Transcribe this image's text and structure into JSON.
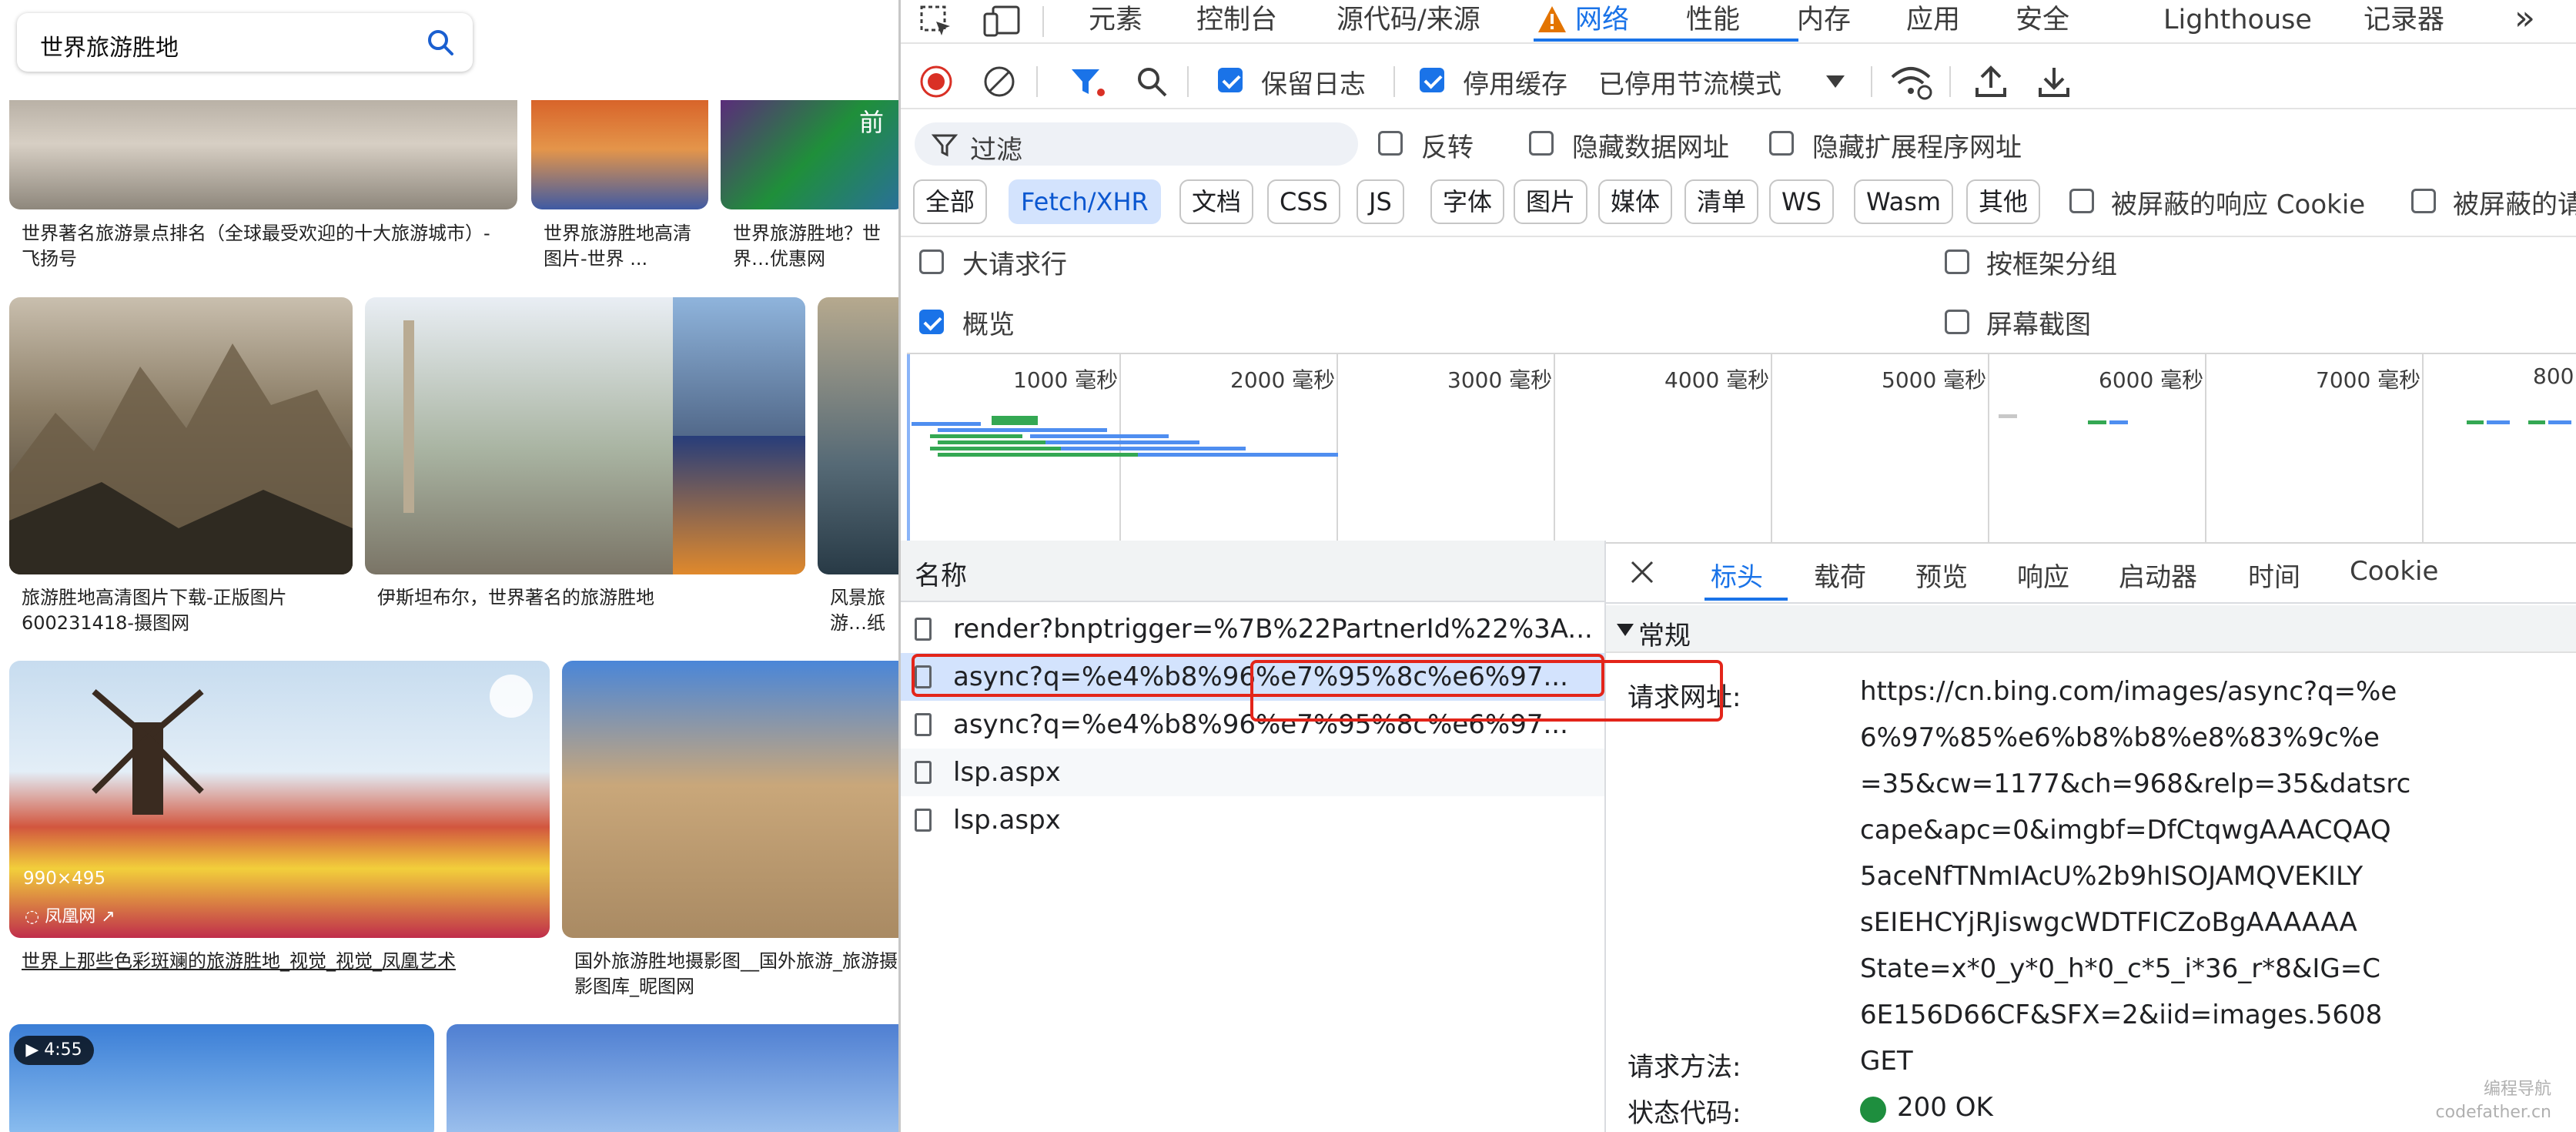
{
  "search": {
    "query": "世界旅游胜地"
  },
  "results": {
    "row1": [
      {
        "caption": "世界著名旅游景点排名（全球最受欢迎的十大旅游城市）-飞扬号"
      },
      {
        "caption": "世界旅游胜地高清图片-世界 ..."
      },
      {
        "caption": "世界旅游胜地？世界…优惠网",
        "overlay": "前"
      }
    ],
    "row2": [
      {
        "caption": "旅游胜地高清图片下载-正版图片600231418-摄图网"
      },
      {
        "caption": "伊斯坦布尔，世界著名的旅游胜地"
      },
      {
        "caption": "风景旅游…纸网"
      }
    ],
    "row3": [
      {
        "caption": "世界上那些色彩斑斓的旅游胜地_视觉_视觉_凤凰艺术",
        "dims": "990×495",
        "source": "凤凰网"
      },
      {
        "caption": "国外旅游胜地摄影图__国外旅游_旅游摄影图库_昵图网"
      }
    ],
    "row4": [
      {
        "duration": "4:55"
      }
    ]
  },
  "devtools": {
    "tabs": [
      "元素",
      "控制台",
      "源代码/来源",
      "网络",
      "性能",
      "内存",
      "应用",
      "安全",
      "Lighthouse",
      "记录器"
    ],
    "more": "»",
    "toolbar": {
      "preserve_log": "保留日志",
      "disable_cache": "停用缓存",
      "throttling": "已停用节流模式"
    },
    "filter": {
      "placeholder": "过滤",
      "invert": "反转",
      "hide_data_urls": "隐藏数据网址",
      "hide_ext_urls": "隐藏扩展程序网址"
    },
    "types": [
      "全部",
      "Fetch/XHR",
      "文档",
      "CSS",
      "JS",
      "字体",
      "图片",
      "媒体",
      "清单",
      "WS",
      "Wasm",
      "其他"
    ],
    "blocked_cookies": "被屏蔽的响应 Cookie",
    "blocked_requests": "被屏蔽的请",
    "options": {
      "big_rows": "大请求行",
      "group_by_frame": "按框架分组",
      "overview": "概览",
      "screenshots": "屏幕截图"
    },
    "overview_ticks": [
      "1000 毫秒",
      "2000 毫秒",
      "3000 毫秒",
      "4000 毫秒",
      "5000 毫秒",
      "6000 毫秒",
      "7000 毫秒",
      "800"
    ],
    "list_header": "名称",
    "requests": [
      "render?bnptrigger=%7B%22PartnerId%22%3A...",
      "async?q=%e4%b8%96%e7%95%8c%e6%97...",
      "async?q=%e4%b8%96%e7%95%8c%e6%97...",
      "lsp.aspx",
      "lsp.aspx"
    ],
    "detail_tabs": [
      "标头",
      "载荷",
      "预览",
      "响应",
      "启动器",
      "时间",
      "Cookie"
    ],
    "general_label": "常规",
    "request_url_label": "请求网址:",
    "request_url_lines": [
      "https://cn.bing.com/images/async?q=%e",
      "6%97%85%e6%b8%b8%e8%83%9c%e",
      "=35&cw=1177&ch=968&relp=35&datsrc",
      "cape&apc=0&imgbf=DfCtqwgAAACQAQ",
      "5aceNfTNmIAcU%2b9hISOJAMQVEKILY",
      "sEIEHCYjRJiswgcWDTFICZoBgAAAAAA",
      "State=x*0_y*0_h*0_c*5_i*36_r*8&IG=C",
      "6E156D66CF&SFX=2&iid=images.5608"
    ],
    "request_method_label": "请求方法:",
    "request_method": "GET",
    "status_code_label": "状态代码:",
    "status_code": "200 OK"
  },
  "watermark": [
    "编程导航",
    "codefather.cn"
  ],
  "colors": {
    "accent": "#1a73e8",
    "highlight": "#e3251a",
    "ok": "#1e8e3e",
    "record": "#d93025"
  }
}
